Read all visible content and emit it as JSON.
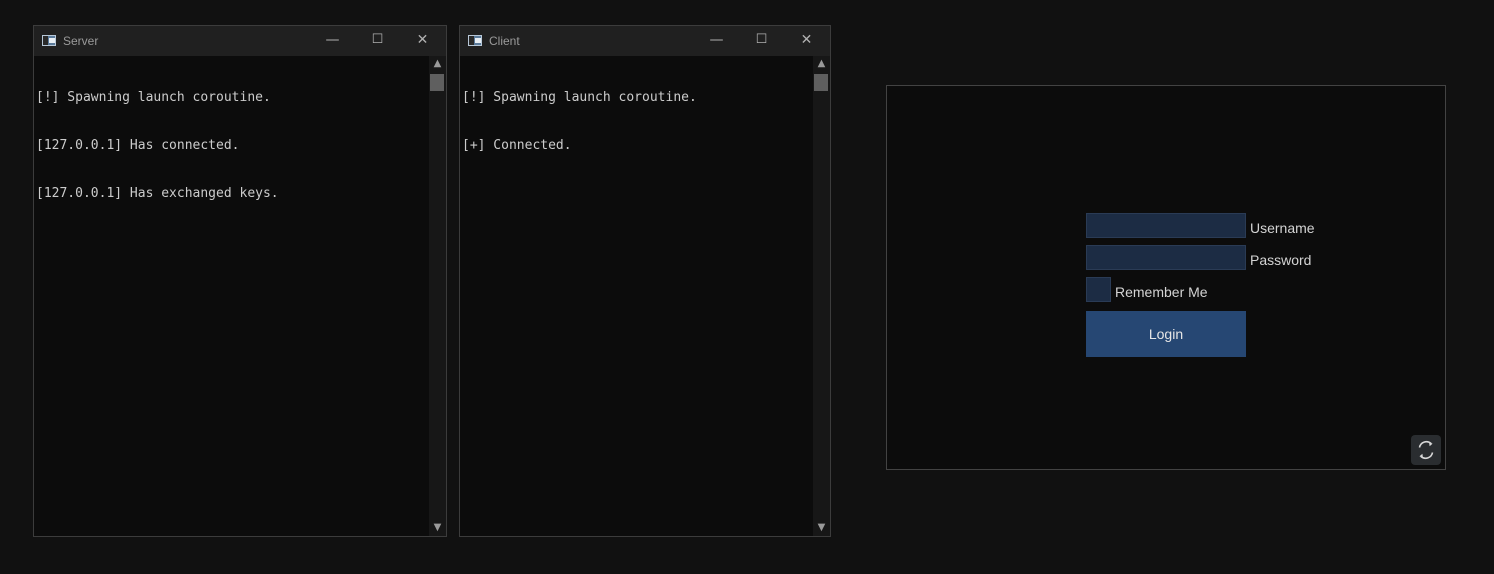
{
  "server_window": {
    "title": "Server",
    "icon": "console-app-icon",
    "buttons": {
      "minimize": "—",
      "maximize": "☐",
      "close": "✕"
    },
    "lines": [
      "[!] Spawning launch coroutine.",
      "[127.0.0.1] Has connected.",
      "[127.0.0.1] Has exchanged keys."
    ]
  },
  "client_window": {
    "title": "Client",
    "icon": "console-app-icon",
    "buttons": {
      "minimize": "—",
      "maximize": "☐",
      "close": "✕"
    },
    "lines": [
      "[!] Spawning launch coroutine.",
      "[+] Connected."
    ]
  },
  "scrollbar": {
    "up_arrow": "▲",
    "down_arrow": "▼"
  },
  "login": {
    "username_value": "",
    "username_label": "Username",
    "password_value": "",
    "password_label": "Password",
    "remember_checked": false,
    "remember_label": "Remember Me",
    "login_button": "Login",
    "refresh_icon": "refresh-icon"
  },
  "colors": {
    "background": "#111111",
    "console_bg": "#0c0c0c",
    "field_bg": "#1c2c44",
    "button_bg": "#264773"
  }
}
